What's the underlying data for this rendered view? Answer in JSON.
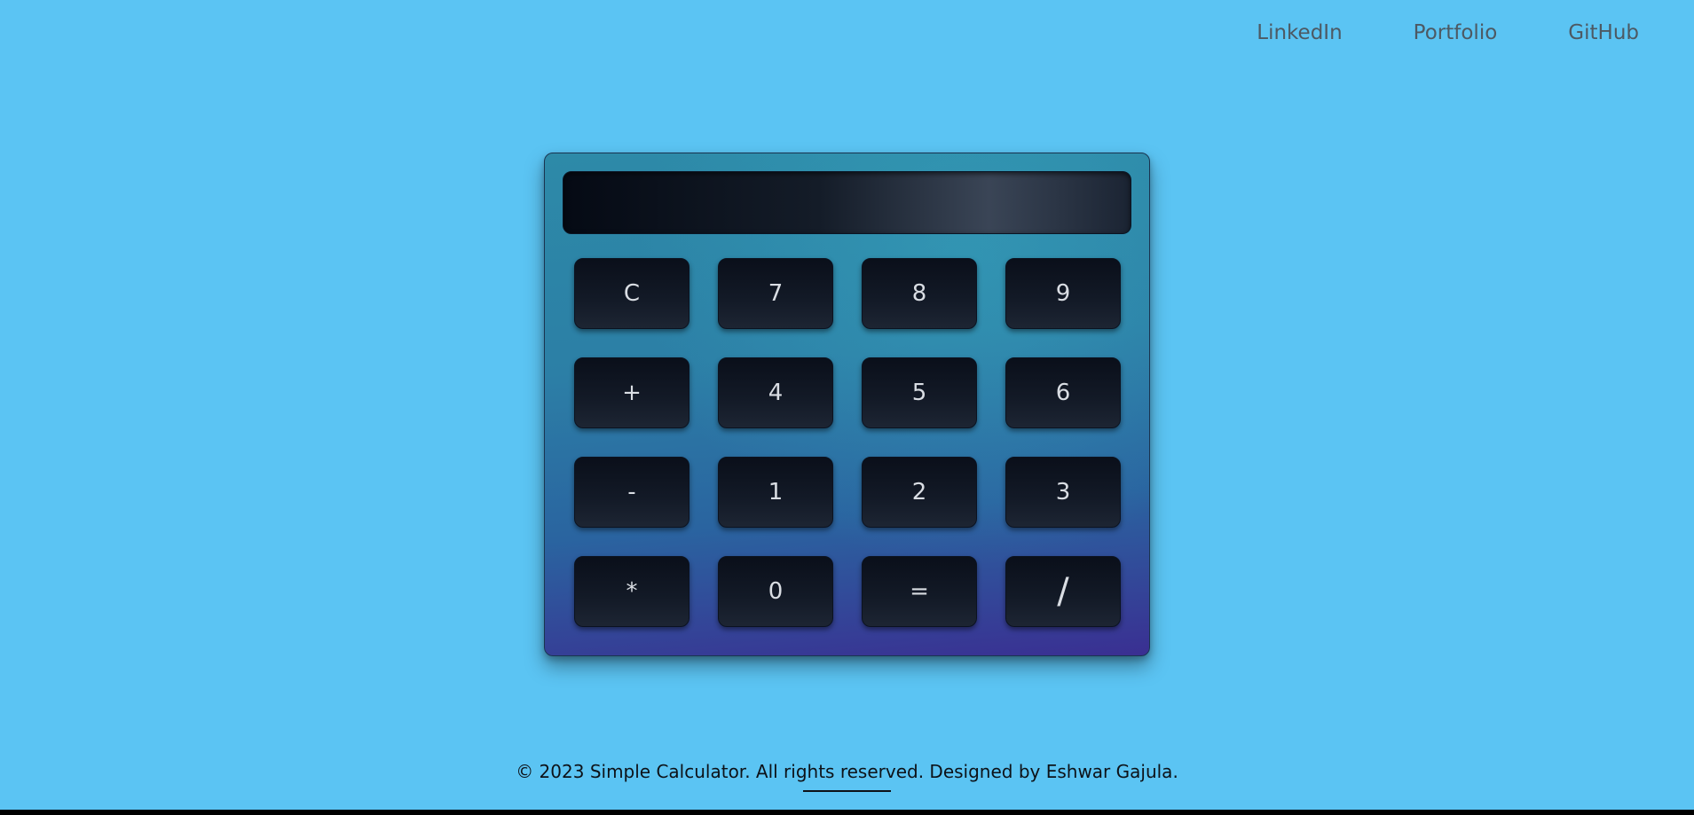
{
  "nav": {
    "links": [
      "LinkedIn",
      "Portfolio",
      "GitHub"
    ]
  },
  "calculator": {
    "display_value": "",
    "keys": [
      "C",
      "7",
      "8",
      "9",
      "+",
      "4",
      "5",
      "6",
      "-",
      "1",
      "2",
      "3",
      "*",
      "0",
      "=",
      "/"
    ]
  },
  "footer": {
    "text": "© 2023 Simple Calculator. All rights reserved. Designed by Eshwar Gajula."
  },
  "colors": {
    "background": "#5bc4f3",
    "nav_text": "#4d5963",
    "key_text": "#d9dde3"
  }
}
